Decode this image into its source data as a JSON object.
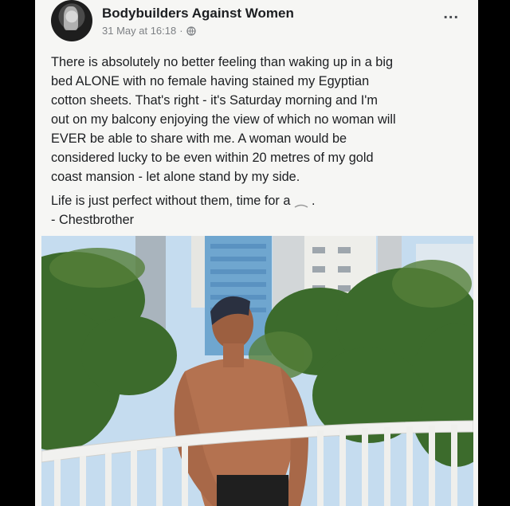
{
  "post": {
    "page_name": "Bodybuilders Against Women",
    "timestamp": "31 May at 16:18",
    "separator": "·",
    "privacy_icon": "globe-icon",
    "more_icon": "more-dots-icon",
    "more_label": "...",
    "text_lines": [
      "There is absolutely no better feeling than waking up in a big",
      "bed ALONE with no female having stained my Egyptian",
      "cotton sheets. That's right - it's Saturday morning and I'm",
      "out on my balcony enjoying the view of which no woman will",
      "EVER be able to share with me. A woman would be",
      "considered lucky to be even within 20 metres of my gold",
      "coast mansion - let alone stand by my side."
    ],
    "closing_line": "Life is just perfect without them, time for a",
    "closing_emoji": "emoji",
    "closing_punct": ".",
    "signature": "- Chestbrother"
  },
  "colors": {
    "page_name": "#1c1e21",
    "meta": "#7d8084",
    "background": "#f6f6f4"
  }
}
